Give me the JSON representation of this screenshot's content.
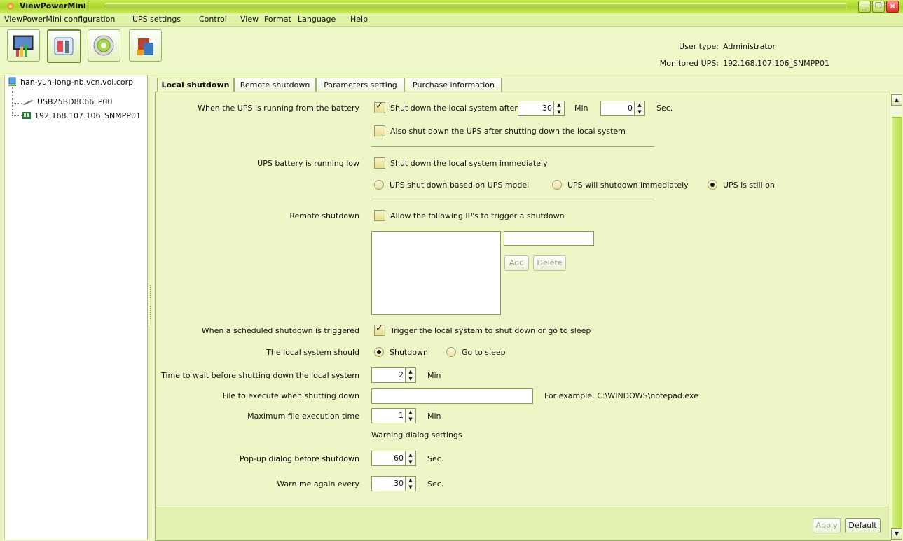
{
  "window": {
    "title": "ViewPowerMini"
  },
  "menu": [
    "ViewPowerMini configuration",
    "UPS settings",
    "Control",
    "View",
    "Format",
    "Language",
    "Help"
  ],
  "toolbar": {
    "buttons": [
      "monitor-icon",
      "tools-icon",
      "settings-disk-icon",
      "building-icon"
    ],
    "user_type_label": "User type:",
    "user_type_value": "Administrator",
    "monitored_label": "Monitored UPS:",
    "monitored_value": "192.168.107.106_SNMPP01"
  },
  "tree": {
    "root": "han-yun-long-nb.vcn.vol.corp",
    "children": [
      "USB25BD8C66_P00",
      "192.168.107.106_SNMPP01"
    ]
  },
  "tabs": [
    "Local shutdown",
    "Remote shutdown",
    "Parameters setting",
    "Purchase information"
  ],
  "form": {
    "battery_label": "When the UPS is running from the battery",
    "shutdown_after_label": "Shut down the local system after",
    "shutdown_after_min": "30",
    "min_unit": "Min",
    "shutdown_after_sec": "0",
    "sec_unit": "Sec.",
    "also_shutdown_ups": "Also shut down the UPS after shutting down the local system",
    "battery_low_label": "UPS battery is running low",
    "shutdown_immediately": "Shut down the local system immediately",
    "radio_model": "UPS shut down based on UPS model",
    "radio_immediate": "UPS will shutdown immediately",
    "radio_still_on": "UPS is still on",
    "remote_label": "Remote shutdown",
    "allow_ips": "Allow the following IP's to trigger a shutdown",
    "add_btn": "Add",
    "delete_btn": "Delete",
    "scheduled_label": "When a scheduled shutdown is triggered",
    "trigger_local": "Trigger the local system to shut down or go to sleep",
    "local_should_label": "The local system should",
    "radio_shutdown": "Shutdown",
    "radio_sleep": "Go to sleep",
    "wait_label": "Time to wait before shutting down the local system",
    "wait_value": "2",
    "file_label": "File to execute when shutting down",
    "file_value": "",
    "file_example": "For example: C:\\WINDOWS\\notepad.exe",
    "max_exec_label": "Maximum file execution time",
    "max_exec_value": "1",
    "warning_heading": "Warning dialog settings",
    "popup_label": "Pop-up dialog before shutdown",
    "popup_value": "60",
    "warn_again_label": "Warn me again every",
    "warn_again_value": "30"
  },
  "footer": {
    "apply": "Apply",
    "default": "Default"
  },
  "colors": {
    "titlebar": "#b5dd35",
    "panel": "#eef6c8",
    "accent": "#9bb267"
  }
}
